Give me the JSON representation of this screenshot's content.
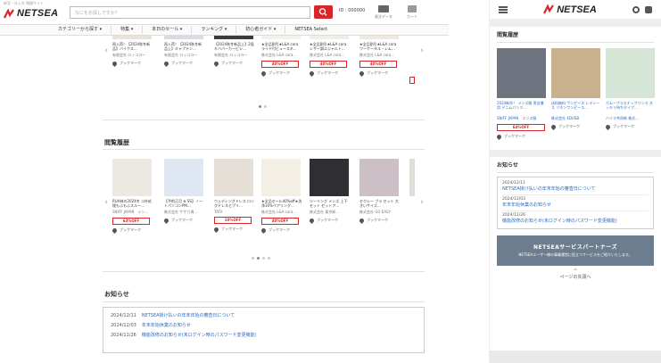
{
  "header": {
    "tagline": "卸売・仕入れ 問屋サイト",
    "logo_text": "NETSEA",
    "search_placeholder": "なにをお探しですか？",
    "id_label": "ID : 000000",
    "icons": [
      {
        "name": "purchase-history-icon",
        "label": "発注データ"
      },
      {
        "name": "cart-icon",
        "label": "カート"
      }
    ]
  },
  "nav": [
    "カテゴリーから探す ▾",
    "特集 ▾",
    "本日のセール ▾",
    "ランキング ▾",
    "初心者ガイド ▾",
    "NETSEA Select"
  ],
  "top_carousel": {
    "cards": [
      {
        "title": "再入荷！【2024秋冬新品】バイクス…",
        "shop": "有限会社 ロッコヨー",
        "off": "",
        "bookmark": "ブックマーク"
      },
      {
        "title": "再入荷！【2024秋冬新品上】キャプテン…",
        "shop": "有限会社 ロッコヨー",
        "off": "",
        "bookmark": "ブックマーク"
      },
      {
        "title": "【2024秋冬新品上】2段キバパーカービシ…",
        "shop": "有限会社 ロッコヨー",
        "off": "",
        "bookmark": "ブックマーク"
      },
      {
        "title": "★全品割引★L&A cora ライド付ビュースネ…",
        "shop": "株式会社 L&A cora…",
        "off": "40%OFF",
        "bookmark": "ブックマーク"
      },
      {
        "title": "★全品割引★L&A cora レザー調エジャルト…",
        "shop": "株式会社 L&A cora…",
        "off": "40%OFF",
        "bookmark": "ブックマーク"
      },
      {
        "title": "★全品割引★L&A cora ワーケータル・レム…",
        "shop": "株式会社 L&A cora…",
        "off": "40%OFF",
        "bookmark": "ブックマーク"
      }
    ]
  },
  "history": {
    "title": "閲覧履歴",
    "cards": [
      {
        "title": "RUA林の2024冬 コ外処理もふもふスルー…",
        "shop": "SNIFF JAPAN　メン…",
        "off": "63%OFF",
        "bookmark": "ブックマーク"
      },
      {
        "title": "【予約正月 ⊕ SS】ノートパソコンPM…",
        "shop": "株式会社 サザカ現…",
        "off": "",
        "bookmark": "ブックマーク"
      },
      {
        "title": "ウェディングドレス ロングドレスとプリ…",
        "shop": "TATA",
        "off": "10%OFF",
        "bookmark": "ブックマーク"
      },
      {
        "title": "★全品セール40%off★洗浄10%ペアリング…",
        "shop": "株式会社 L&A cora…",
        "off": "40%OFF",
        "bookmark": "ブックマーク"
      },
      {
        "title": "ツーリング メンズ 上下セット セットア…",
        "shop": "株式会社 東京卸…",
        "off": "",
        "bookmark": "ブックマーク"
      },
      {
        "title": "セクシー ブラ セット 大きいサイズ…",
        "shop": "株式会社 GO EASY",
        "off": "",
        "bookmark": "ブックマーク"
      }
    ]
  },
  "news": {
    "title": "お知らせ",
    "items": [
      {
        "date": "2024/12/11",
        "text": "NETSEA掛け払いの年末年始の審査日について"
      },
      {
        "date": "2024/12/03",
        "text": "年末年始休業のお知らせ"
      },
      {
        "date": "2024/11/26",
        "text": "機能改修のお知らせ(未ログイン時のパスワード変更機能)"
      }
    ]
  },
  "mobile": {
    "logo_text": "NETSEA",
    "history_title": "閲覧履歴",
    "cards": [
      {
        "title": "2024新作！ メンズ服 男女兼用 デニムパンツ…",
        "shop": "SNIFF JAPAN　メンズ服",
        "off": "64%OFF",
        "bookmark": "ブックマーク"
      },
      {
        "title": "送料無料 ワンピース レディース リネンワンピース…",
        "shop": "株式会社 4DUSB",
        "off": "",
        "bookmark": "ブックマーク"
      },
      {
        "title": "ガムープラスチックリンス スッキリ待ちタイプ…",
        "shop": "ハリマ共同株 株式…",
        "off": "",
        "bookmark": "ブックマーク"
      }
    ],
    "news_title": "お知らせ",
    "news": [
      {
        "date": "2024/12/11",
        "text": "NETSEA掛け払いの年末年始の審査日について"
      },
      {
        "date": "2024/12/03",
        "text": "年末年始休業のお知らせ"
      },
      {
        "date": "2024/11/26",
        "text": "機能改修のお知らせ(未ログイン時のパスワード変更機能)"
      }
    ],
    "partner_title": "NETSEAサービスパートナーズ",
    "partner_sub": "NETSEAユーザー様の事業運営に役立つサービスをご紹介いたします。",
    "page_top": "ページの先頭へ"
  },
  "colors": {
    "brand_red": "#d9262b",
    "link_blue": "#2a6cc4",
    "partner_bg": "#6b7d8f"
  }
}
